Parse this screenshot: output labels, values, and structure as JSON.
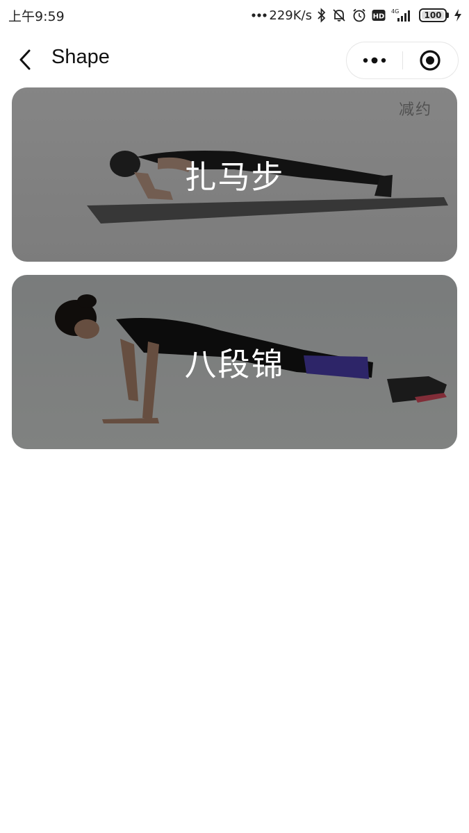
{
  "status_bar": {
    "time": "上午9:59",
    "network_speed": "229K/s",
    "network_type": "4G",
    "battery": "100"
  },
  "nav": {
    "title": "Shape"
  },
  "cards": [
    {
      "title": "扎马步",
      "watermark": "减约"
    },
    {
      "title": "八段锦"
    }
  ],
  "colors": {
    "card_overlay": "#000000",
    "card_title": "#ffffff"
  }
}
